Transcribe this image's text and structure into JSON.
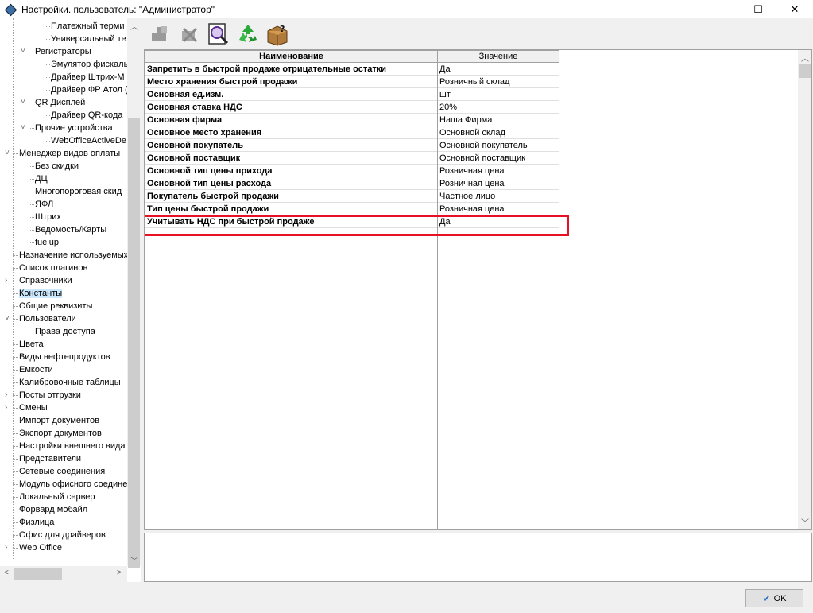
{
  "window": {
    "title": "Настройки. пользователь: \"Администратор\"",
    "minimize_glyph": "—",
    "maximize_glyph": "☐",
    "close_glyph": "✕"
  },
  "toolbar": {
    "buttons": [
      {
        "name": "add-icon",
        "tip": ""
      },
      {
        "name": "delete-icon",
        "tip": ""
      },
      {
        "name": "search-icon",
        "tip": ""
      },
      {
        "name": "refresh-icon",
        "tip": ""
      },
      {
        "name": "package-help-icon",
        "tip": ""
      }
    ]
  },
  "tree": {
    "items": [
      {
        "label": "Платежный терми",
        "level": 5,
        "expander": ""
      },
      {
        "label": "Универсальный те",
        "level": 5,
        "expander": ""
      },
      {
        "label": "Регистраторы",
        "level": 4,
        "expander": "v"
      },
      {
        "label": "Эмулятор фискаль",
        "level": 5,
        "expander": ""
      },
      {
        "label": "Драйвер Штрих-М",
        "level": 5,
        "expander": ""
      },
      {
        "label": "Драйвер ФР Атол (",
        "level": 5,
        "expander": ""
      },
      {
        "label": "QR Дисплей",
        "level": 4,
        "expander": "v"
      },
      {
        "label": "Драйвер QR-кода",
        "level": 5,
        "expander": ""
      },
      {
        "label": "Прочие устройства",
        "level": 4,
        "expander": "v"
      },
      {
        "label": "WebOfficeActiveDe",
        "level": 5,
        "expander": ""
      },
      {
        "label": "Менеджер видов оплаты",
        "level": 2,
        "expander": "v"
      },
      {
        "label": "Без скидки",
        "level": 3,
        "expander": ""
      },
      {
        "label": "ДЦ",
        "level": 3,
        "expander": ""
      },
      {
        "label": "Многопороговая скид",
        "level": 3,
        "expander": ""
      },
      {
        "label": "ЯФЛ",
        "level": 3,
        "expander": ""
      },
      {
        "label": "Штрих",
        "level": 3,
        "expander": ""
      },
      {
        "label": "Ведомость/Карты",
        "level": 3,
        "expander": ""
      },
      {
        "label": "fuelup",
        "level": 3,
        "expander": ""
      },
      {
        "label": "Назначение используемых",
        "level": 2,
        "expander": ""
      },
      {
        "label": "Список плагинов",
        "level": 2,
        "expander": ""
      },
      {
        "label": "Справочники",
        "level": 2,
        "expander": ">"
      },
      {
        "label": "Константы",
        "level": 2,
        "expander": "",
        "selected": true
      },
      {
        "label": "Общие реквизиты",
        "level": 2,
        "expander": ""
      },
      {
        "label": "Пользователи",
        "level": 2,
        "expander": "v"
      },
      {
        "label": "Права доступа",
        "level": 3,
        "expander": ""
      },
      {
        "label": "Цвета",
        "level": 2,
        "expander": ""
      },
      {
        "label": "Виды нефтепродуктов",
        "level": 2,
        "expander": ""
      },
      {
        "label": "Емкости",
        "level": 2,
        "expander": ""
      },
      {
        "label": "Калибровочные таблицы",
        "level": 2,
        "expander": ""
      },
      {
        "label": "Посты отгрузки",
        "level": 2,
        "expander": ">"
      },
      {
        "label": "Смены",
        "level": 2,
        "expander": ">"
      },
      {
        "label": "Импорт документов",
        "level": 2,
        "expander": ""
      },
      {
        "label": "Экспорт документов",
        "level": 2,
        "expander": ""
      },
      {
        "label": "Настройки внешнего вида",
        "level": 2,
        "expander": ""
      },
      {
        "label": "Представители",
        "level": 2,
        "expander": ""
      },
      {
        "label": "Сетевые соединения",
        "level": 2,
        "expander": ""
      },
      {
        "label": "Модуль офисного соедине",
        "level": 2,
        "expander": ""
      },
      {
        "label": "Локальный сервер",
        "level": 2,
        "expander": ""
      },
      {
        "label": "Форвард мобайл",
        "level": 2,
        "expander": ""
      },
      {
        "label": "Физлица",
        "level": 2,
        "expander": ""
      },
      {
        "label": "Офис для драйверов",
        "level": 2,
        "expander": ""
      },
      {
        "label": "Web Office",
        "level": 2,
        "expander": ">"
      }
    ]
  },
  "grid": {
    "columns": [
      "Наименование",
      "Значение"
    ],
    "rows": [
      {
        "name": "Запретить в быстрой продаже отрицательные остатки",
        "value": "Да"
      },
      {
        "name": "Место хранения быстрой продажи",
        "value": "Розничный склад"
      },
      {
        "name": "Основная ед.изм.",
        "value": "шт"
      },
      {
        "name": "Основная ставка НДС",
        "value": "20%"
      },
      {
        "name": "Основная фирма",
        "value": "Наша Фирма"
      },
      {
        "name": "Основное место хранения",
        "value": "Основной склад"
      },
      {
        "name": "Основной покупатель",
        "value": "Основной покупатель"
      },
      {
        "name": "Основной поставщик",
        "value": "Основной поставщик"
      },
      {
        "name": "Основной тип цены прихода",
        "value": "Розничная цена"
      },
      {
        "name": "Основной тип цены расхода",
        "value": "Розничная цена"
      },
      {
        "name": "Покупатель быстрой продажи",
        "value": "Частное лицо"
      },
      {
        "name": "Тип цены быстрой продажи",
        "value": "Розничная цена"
      },
      {
        "name": "Учитывать НДС при быстрой продаже",
        "value": "Да",
        "highlighted": true
      }
    ],
    "highlight_color": "#e81123"
  },
  "footer": {
    "ok_label": "OK"
  }
}
